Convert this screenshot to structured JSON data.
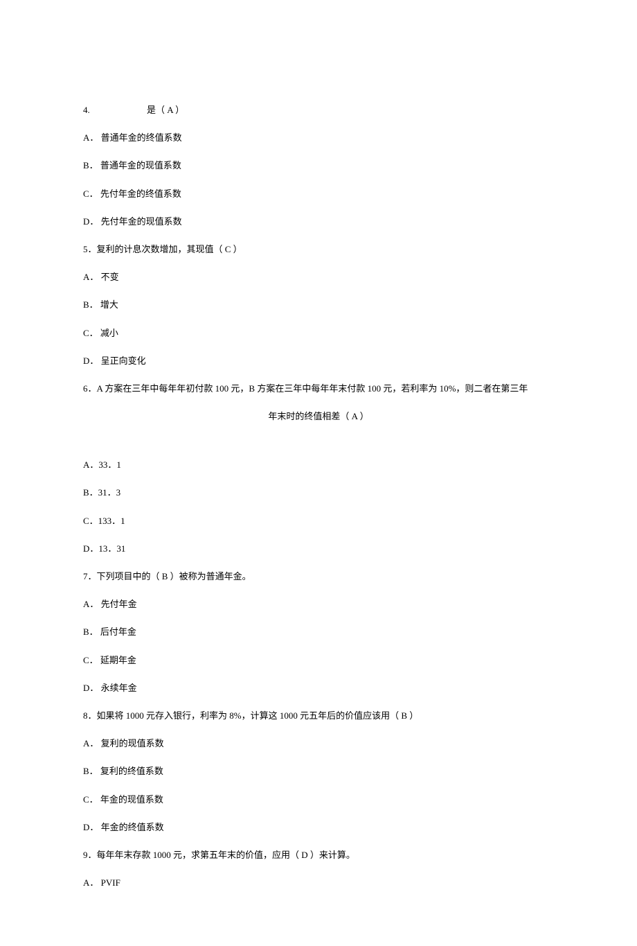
{
  "q4": {
    "prefix": "4.",
    "stem_suffix": "是（ A  ）",
    "options": {
      "A": "A．  普通年金的终值系数",
      "B": "B．  普通年金的现值系数",
      "C": "C．  先付年金的终值系数",
      "D": "D．  先付年金的现值系数"
    }
  },
  "q5": {
    "stem": "5．复利的计息次数增加，其现值（  C ）",
    "options": {
      "A": "A．  不变",
      "B": "B．  增大",
      "C": "C．  减小",
      "D": "D．  呈正向变化"
    }
  },
  "q6": {
    "stem": "6．A 方案在三年中每年年初付款 100 元，B 方案在三年中每年年末付款 100 元，若利率为 10%，则二者在第三年",
    "stem_line2": "年末时的终值相差（ A  ）",
    "options": {
      "A": "A．33．1",
      "B": "B．31．3",
      "C": "C．133．1",
      "D": "D．13．31"
    }
  },
  "q7": {
    "stem": "7．下列项目中的（ B  ）被称为普通年金。",
    "options": {
      "A": "A．    先付年金",
      "B": "B．    后付年金",
      "C": "C．    延期年金",
      "D": "D．    永续年金"
    }
  },
  "q8": {
    "stem": "8．如果将 1000 元存入银行，利率为 8%，计算这 1000 元五年后的价值应该用（ B  ）",
    "options": {
      "A": "A．    复利的现值系数",
      "B": "B．    复利的终值系数",
      "C": "C．    年金的现值系数",
      "D": "D．    年金的终值系数"
    }
  },
  "q9": {
    "stem": "9．每年年末存款 1000 元，求第五年末的价值，应用（ D  ）来计算。",
    "options": {
      "A": "A．    PVIF"
    }
  }
}
